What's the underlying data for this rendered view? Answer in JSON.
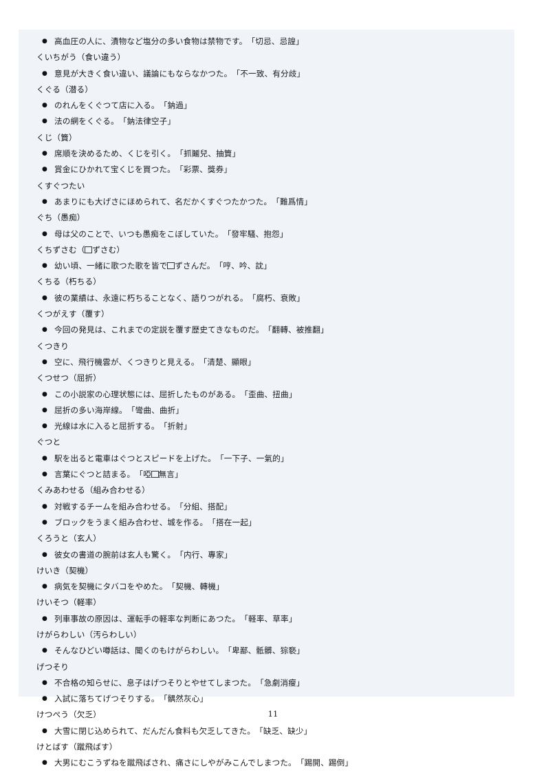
{
  "document": {
    "page_number": "11",
    "background_color": "#ffffff",
    "block_color": "#f0f4f9",
    "text_color": "#16181c"
  },
  "bullet_glyph": "●",
  "entries": [
    {
      "type": "example",
      "text": "高血圧の人に、漬物など塩分の多い食物は禁物です。　「切忌、忌諻」"
    },
    {
      "type": "headword",
      "text": "くいちがう（食い違う）"
    },
    {
      "type": "example",
      "text": "意見が大きく食い違い、議論にもならなかつた。　「不一致、有分歧」"
    },
    {
      "type": "headword",
      "text": "くぐる（潜る）"
    },
    {
      "type": "example",
      "text": "のれんをくぐつて店に入る。　「鈉過」"
    },
    {
      "type": "example",
      "text": "法の網をくぐる。　「鈉法律空子」"
    },
    {
      "type": "headword",
      "text": "くじ（簤）"
    },
    {
      "type": "example",
      "text": "席順を決めるため、くじを引く。　「抓鬮兒、抽簤」"
    },
    {
      "type": "example",
      "text": "賞金にひかれて宝くじを買つた。　「彩票、獎券」"
    },
    {
      "type": "headword",
      "text": "くすぐつたい"
    },
    {
      "type": "example",
      "text": "あまりにも大げさにほめられて、名だかくすぐつたかつた。　「難爲情」"
    },
    {
      "type": "headword",
      "text": "ぐち（愚痴）"
    },
    {
      "type": "example",
      "text": "母は父のことで、いつも愚痴をこぼしていた。　「發牢騷、抱怨」"
    },
    {
      "type": "headword",
      "html": "くちずさむ（<span class=\"missing-glyph\"></span>ずさむ）"
    },
    {
      "type": "example",
      "html": "幼い頃、一緒に歌つた歌を皆で<span class=\"missing-glyph\"></span>ずさんだ。　「哼、吟、訦」"
    },
    {
      "type": "headword",
      "text": "くちる（朽ちる）"
    },
    {
      "type": "example",
      "text": "彼の業績は、永遠に朽ちることなく、語りつがれる。　「腐朽、衰敗」"
    },
    {
      "type": "headword",
      "text": "くつがえす（覆す）"
    },
    {
      "type": "example",
      "text": "今回の発見は、これまでの定説を覆す歴史てきなものだ。　「翻轉、被推翻」"
    },
    {
      "type": "headword",
      "text": "くつきり"
    },
    {
      "type": "example",
      "text": "空に、飛行機雲が、くつきりと見える。　「清楚、顯眼」"
    },
    {
      "type": "headword",
      "text": "くつせつ（屈折）"
    },
    {
      "type": "example",
      "text": "この小説家の心理状態には、屈折したものがある。　「歪曲、扭曲」"
    },
    {
      "type": "example",
      "text": "屈折の多い海岸線。　「彎曲、曲折」"
    },
    {
      "type": "example",
      "text": "光線は水に入ると屈折する。　「折射」"
    },
    {
      "type": "headword",
      "text": "ぐつと"
    },
    {
      "type": "example",
      "text": "駅を出ると電車はぐつとスピードを上げた。　「一下子、一氣的」"
    },
    {
      "type": "example",
      "html": "言葉にぐつと詰まる。　「啞<span class=\"missing-glyph\"></span>無言」"
    },
    {
      "type": "headword",
      "text": "くみあわせる（組み合わせる）"
    },
    {
      "type": "example",
      "text": "対戦するチームを組み合わせる。　「分組、搭配」"
    },
    {
      "type": "example",
      "text": "ブロックをうまく組み合わせ、城を作る。　「搭在一起」"
    },
    {
      "type": "headword",
      "text": "くろうと（玄人）"
    },
    {
      "type": "example",
      "text": "彼女の書道の腕前は玄人も驚く。　「内行、專家」"
    },
    {
      "type": "headword",
      "text": "けいき（契機）"
    },
    {
      "type": "example",
      "text": "病気を契機にタバコをやめた。　「契機、轉機」"
    },
    {
      "type": "headword",
      "text": "けいそつ（軽率）"
    },
    {
      "type": "example",
      "text": "列車事故の原因は、運転手の軽率な判断にあつた。　「軽率、草率」"
    },
    {
      "type": "headword",
      "text": "けがらわしい（汚らわしい）"
    },
    {
      "type": "example",
      "text": "そんなひどい噂話は、聞くのもけがらわしい。　「卑鄙、骶髒、猔褻」"
    },
    {
      "type": "headword",
      "text": "げつそり"
    },
    {
      "type": "example",
      "text": "不合格の知らせに、息子はげつそりとやせてしまつた。　「急劇消瘦」"
    },
    {
      "type": "example",
      "text": "入試に落ちてげつそりする。　「髃然灰心」"
    },
    {
      "type": "headword",
      "text": "けつぺう（欠乏）"
    },
    {
      "type": "example",
      "text": "大雪に閉じ込められて、だんだん食料も欠乏してきた。　「缺乏、缺少」"
    },
    {
      "type": "headword",
      "text": "けとばす（蹴飛ばす）"
    },
    {
      "type": "example",
      "text": "大男にむこうずねを蹴飛ばされ、痛さにしやがみこんでしまつた。　「踢開、踢倒」"
    }
  ]
}
